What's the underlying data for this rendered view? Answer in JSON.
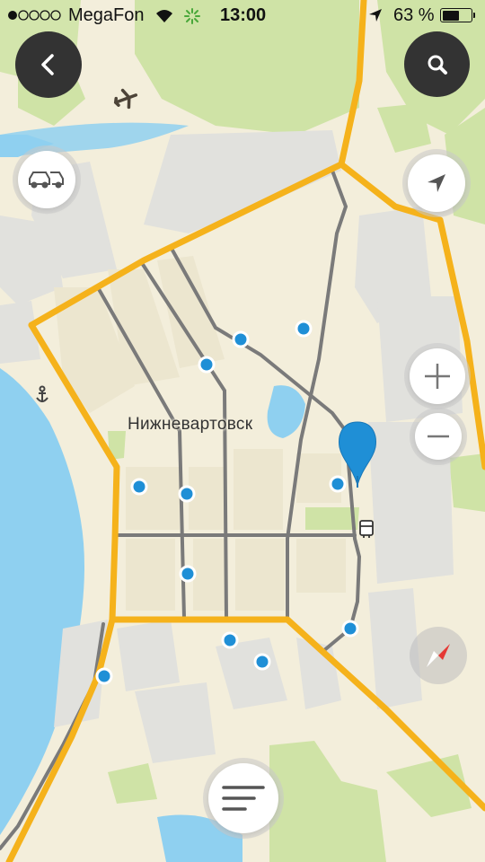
{
  "status_bar": {
    "carrier": "MegaFon",
    "time": "13:00",
    "battery_percent": "63 %",
    "battery_level": 0.63,
    "signal_bars_filled": 1,
    "signal_bars_total": 5
  },
  "map": {
    "city_label": "Нижневартовск",
    "colors": {
      "land": "#f3eedb",
      "park": "#cfe3a6",
      "water": "#8fd0f0",
      "urban": "#e2e2df",
      "road_major": "#f5b21b",
      "road_minor": "#7a7a7a",
      "poi_dot": "#1f8fd6",
      "pin": "#1f8fd6"
    },
    "icons": [
      "airport-icon",
      "anchor-icon",
      "bus-stop-icon"
    ]
  },
  "controls": {
    "back_icon": "chevron-left-icon",
    "search_icon": "search-icon",
    "traffic_icon": "traffic-cars-icon",
    "location_icon": "location-arrow-icon",
    "zoom_in_icon": "plus-icon",
    "zoom_out_icon": "minus-icon",
    "compass_icon": "compass-icon",
    "menu_icon": "menu-lines-icon"
  }
}
